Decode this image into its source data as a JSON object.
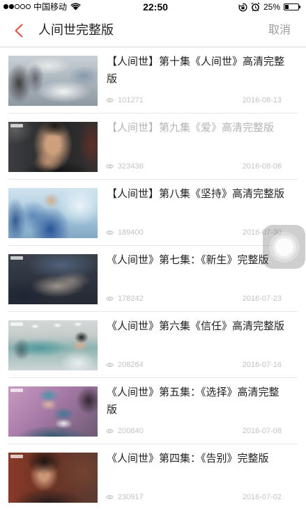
{
  "status_bar": {
    "signal": {
      "strength": 2,
      "total": 5
    },
    "carrier": "中国移动",
    "wifi_icon": "wifi-icon",
    "time": "22:50",
    "orientation_lock_icon": "orientation-lock-icon",
    "alarm_icon": "alarm-clock-icon",
    "battery_text": "25%",
    "battery_level": 0.25,
    "battery_icon": "battery-icon"
  },
  "nav": {
    "back_icon": "chevron-left-icon",
    "title": "人间世完整版",
    "cancel_label": "取消"
  },
  "colors": {
    "accent": "#e5493f",
    "title_text": "#222222",
    "visited_title_text": "#b4b4b4",
    "meta_text": "#c3c3c3",
    "cancel_text": "#9c9c9c"
  },
  "list": {
    "views_icon": "eye-icon",
    "videos": [
      {
        "title": "【人间世】第十集《人间世》高清完整版",
        "views": "101271",
        "date": "2016-08-13",
        "visited": false
      },
      {
        "title": "【人间世】第九集《爱》高清完整版",
        "views": "323436",
        "date": "2016-08-06",
        "visited": true
      },
      {
        "title": "【人间世】第八集《坚持》高清完整版",
        "views": "189400",
        "date": "2016-07-30",
        "visited": false
      },
      {
        "title": "《人间世》第七集：《新生》完整版",
        "views": "178242",
        "date": "2016-07-23",
        "visited": false
      },
      {
        "title": "《人间世》第六集《信任》高清完整版",
        "views": "208264",
        "date": "2016-07-16",
        "visited": false
      },
      {
        "title": "《人间世》第五集：《选择》高清完整版",
        "views": "200840",
        "date": "2016-07-08",
        "visited": false
      },
      {
        "title": "《人间世》第四集：《告别》完整版",
        "views": "230917",
        "date": "2016-07-02",
        "visited": false
      }
    ]
  },
  "assistive_touch": {
    "icon": "assistive-touch-icon"
  }
}
